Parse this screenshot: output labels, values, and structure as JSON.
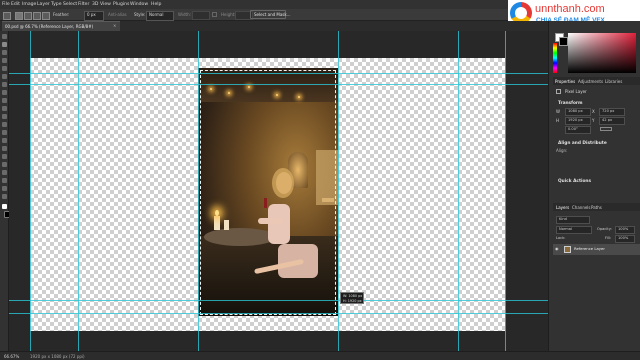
{
  "menu": [
    "File",
    "Edit",
    "Image",
    "Layer",
    "Type",
    "Select",
    "Filter",
    "3D",
    "View",
    "Plugins",
    "Window",
    "Help"
  ],
  "options_bar": {
    "feather_label": "Feather:",
    "feather_value": "0 px",
    "anti_alias_label": "Anti-alias",
    "style_label": "Style:",
    "style_value": "Normal",
    "width_label": "Width:",
    "height_label": "Height:",
    "select_mask_button": "Select and Mask..."
  },
  "document_tab": {
    "title": "00.psd @ 66.7% (Reference Layer, RGB/8#)",
    "close": "×"
  },
  "size_tooltip": {
    "width_line": "W: 1080 px",
    "height_line": "H: 1920 px"
  },
  "watermark": {
    "brand": "unnthanh.com",
    "tagline": "CHIA SẺ ĐAM MÊ VFX"
  },
  "properties": {
    "tabs": [
      "Properties",
      "Adjustments",
      "Libraries"
    ],
    "layer_kind": "Pixel Layer",
    "transform_label": "Transform",
    "w_field": "1080 px",
    "x_field": "720 px",
    "h_field": "1920 px",
    "y_field": "42 px",
    "angle_field": "0.00°",
    "align_label": "Align and Distribute",
    "align_sub": "Align:",
    "quick_actions_label": "Quick Actions"
  },
  "layers_panel": {
    "tabs": [
      "Layers",
      "Channels",
      "Paths"
    ],
    "kind_filter": "Kind",
    "blend_mode": "Normal",
    "opacity_label": "Opacity:",
    "opacity_value": "100%",
    "lock_label": "Lock:",
    "fill_label": "Fill:",
    "fill_value": "100%",
    "layer_name": "Reference Layer"
  },
  "status": {
    "zoom": "66.67%",
    "doc_size": "1920 px x 1080 px (72 ppi)"
  },
  "colors": {
    "guide": "#29c6d6",
    "foreground": "#ffffff",
    "background": "#000000",
    "accent": "#e53935"
  }
}
